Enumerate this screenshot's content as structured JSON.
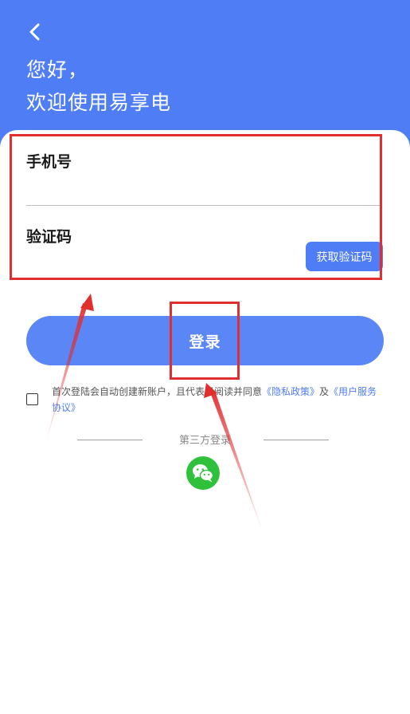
{
  "header": {
    "greeting_line1": "您好，",
    "greeting_line2": "欢迎使用易享电",
    "back_icon": "chevron-left-icon"
  },
  "form": {
    "phone_label": "手机号",
    "phone_value": "",
    "code_label": "验证码",
    "code_value": "",
    "get_code_label": "获取验证码"
  },
  "login": {
    "button_label": "登录"
  },
  "agreement": {
    "checked": false,
    "text_prefix": "首次登陆会自动创建新账户，且代表已阅读并同意",
    "privacy_link": "《隐私政策》",
    "conjunction": "及",
    "service_link": "《用户服务协议》"
  },
  "third_party": {
    "title": "第三方登录",
    "wechat_icon": "wechat-icon"
  },
  "colors": {
    "brand_blue": "#4f7df5",
    "login_blue": "#5b86f6",
    "wechat_green": "#2fc13c",
    "annotation_red": "#e12e2e"
  }
}
